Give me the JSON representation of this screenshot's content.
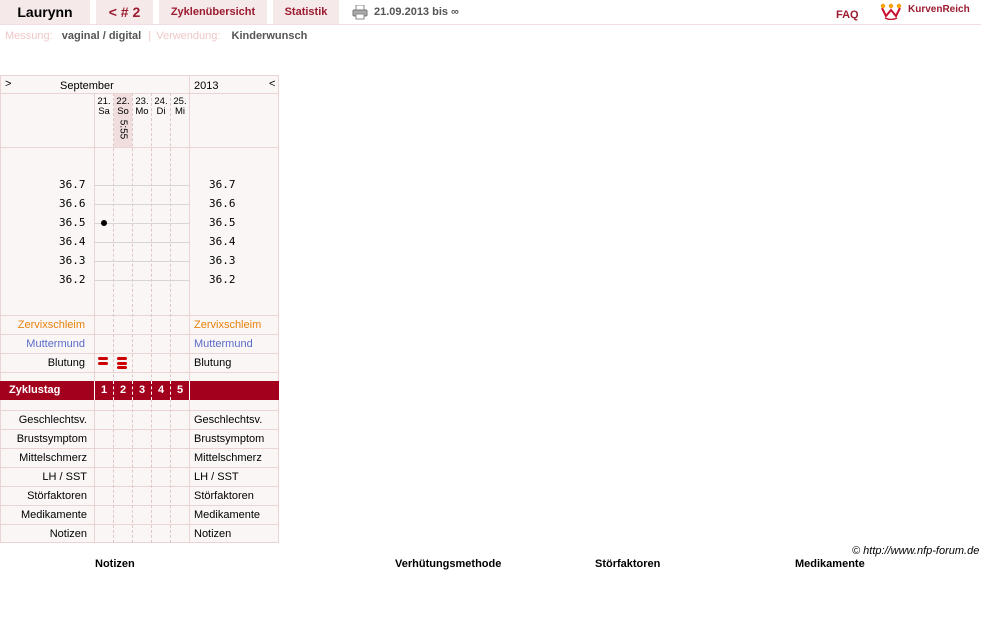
{
  "header": {
    "user": "Laurynn",
    "cycle_nav": "< # 2",
    "tab_overview": "Zyklenübersicht",
    "tab_stats": "Statistik",
    "date_range": "21.09.2013 bis ∞",
    "faq": "FAQ",
    "brand": "KurvenReich"
  },
  "subheader": {
    "measure_label": "Messung:",
    "measure_value": "vaginal / digital",
    "sep": "|",
    "use_label": "Verwendung:",
    "use_value": "Kinderwunsch"
  },
  "chart": {
    "nav_prev": ">",
    "month": "September",
    "year": "2013",
    "nav_next": "<",
    "days": [
      {
        "date": "21.",
        "weekday": "Sa",
        "time": ""
      },
      {
        "date": "22.",
        "weekday": "So",
        "time": "5:55"
      },
      {
        "date": "23.",
        "weekday": "Mo",
        "time": ""
      },
      {
        "date": "24.",
        "weekday": "Di",
        "time": ""
      },
      {
        "date": "25.",
        "weekday": "Mi",
        "time": ""
      }
    ],
    "temp_ticks": [
      "36.7",
      "36.6",
      "36.5",
      "36.4",
      "36.3",
      "36.2"
    ],
    "temperatures": [
      {
        "day": 1,
        "value": 36.5
      }
    ],
    "rows": {
      "zervix": "Zervixschleim",
      "muttermund": "Muttermund",
      "blutung": "Blutung",
      "zyklustag": "Zyklustag",
      "geschlechtsv": "Geschlechtsv.",
      "brust": "Brustsymptom",
      "mittel": "Mittelschmerz",
      "lh": "LH / SST",
      "stoer": "Störfaktoren",
      "medi": "Medikamente",
      "notizen": "Notizen"
    },
    "cycle_days": [
      "1",
      "2",
      "3",
      "4",
      "5"
    ],
    "bleeding_days": [
      1,
      2
    ],
    "colors": {
      "zervix": "#e8820c",
      "muttermund": "#5a6bc8",
      "accent": "#a3001e"
    }
  },
  "footer": {
    "copyright": "© http://www.nfp-forum.de",
    "col_notizen": "Notizen",
    "col_verhuetung": "Verhütungsmethode",
    "col_stoer": "Störfaktoren",
    "col_medi": "Medikamente"
  }
}
